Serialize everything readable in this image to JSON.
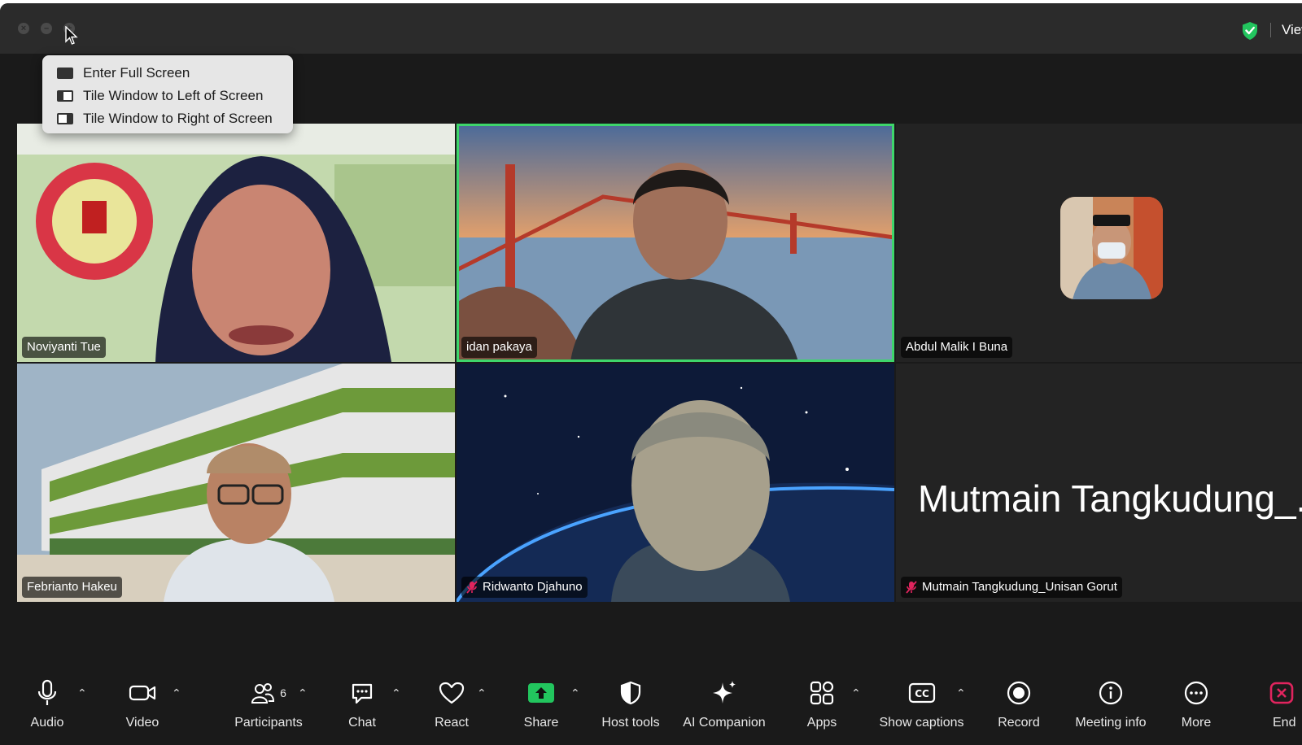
{
  "window": {
    "view_label": "View"
  },
  "menu": {
    "items": [
      {
        "label": "Enter Full Screen",
        "icon": "full-screen-icon"
      },
      {
        "label": "Tile Window to Left of Screen",
        "icon": "tile-left-icon"
      },
      {
        "label": "Tile Window to Right of Screen",
        "icon": "tile-right-icon"
      }
    ]
  },
  "participants": [
    {
      "name": "Noviyanti Tue",
      "muted": false,
      "active": false
    },
    {
      "name": "idan pakaya",
      "muted": false,
      "active": true
    },
    {
      "name": "Abdul Malik I Buna",
      "muted": false,
      "active": false
    },
    {
      "name": "Febrianto Hakeu",
      "muted": false,
      "active": false
    },
    {
      "name": "Ridwanto Djahuno",
      "muted": true,
      "active": false
    },
    {
      "name": "Mutmain Tangkudung_Unisan Gorut",
      "muted": true,
      "active": false,
      "display_name_large": "Mutmain Tangkudung_..."
    }
  ],
  "toolbar": {
    "audio": "Audio",
    "video": "Video",
    "participants": "Participants",
    "participants_count": "6",
    "chat": "Chat",
    "react": "React",
    "share": "Share",
    "host_tools": "Host tools",
    "ai_companion": "AI Companion",
    "apps": "Apps",
    "show_captions": "Show captions",
    "record": "Record",
    "meeting_info": "Meeting info",
    "more": "More",
    "end": "End"
  },
  "colors": {
    "active_speaker": "#3ed66b",
    "share_green": "#22c55e",
    "end_red": "#e0245e",
    "background": "#1a1a1a"
  }
}
